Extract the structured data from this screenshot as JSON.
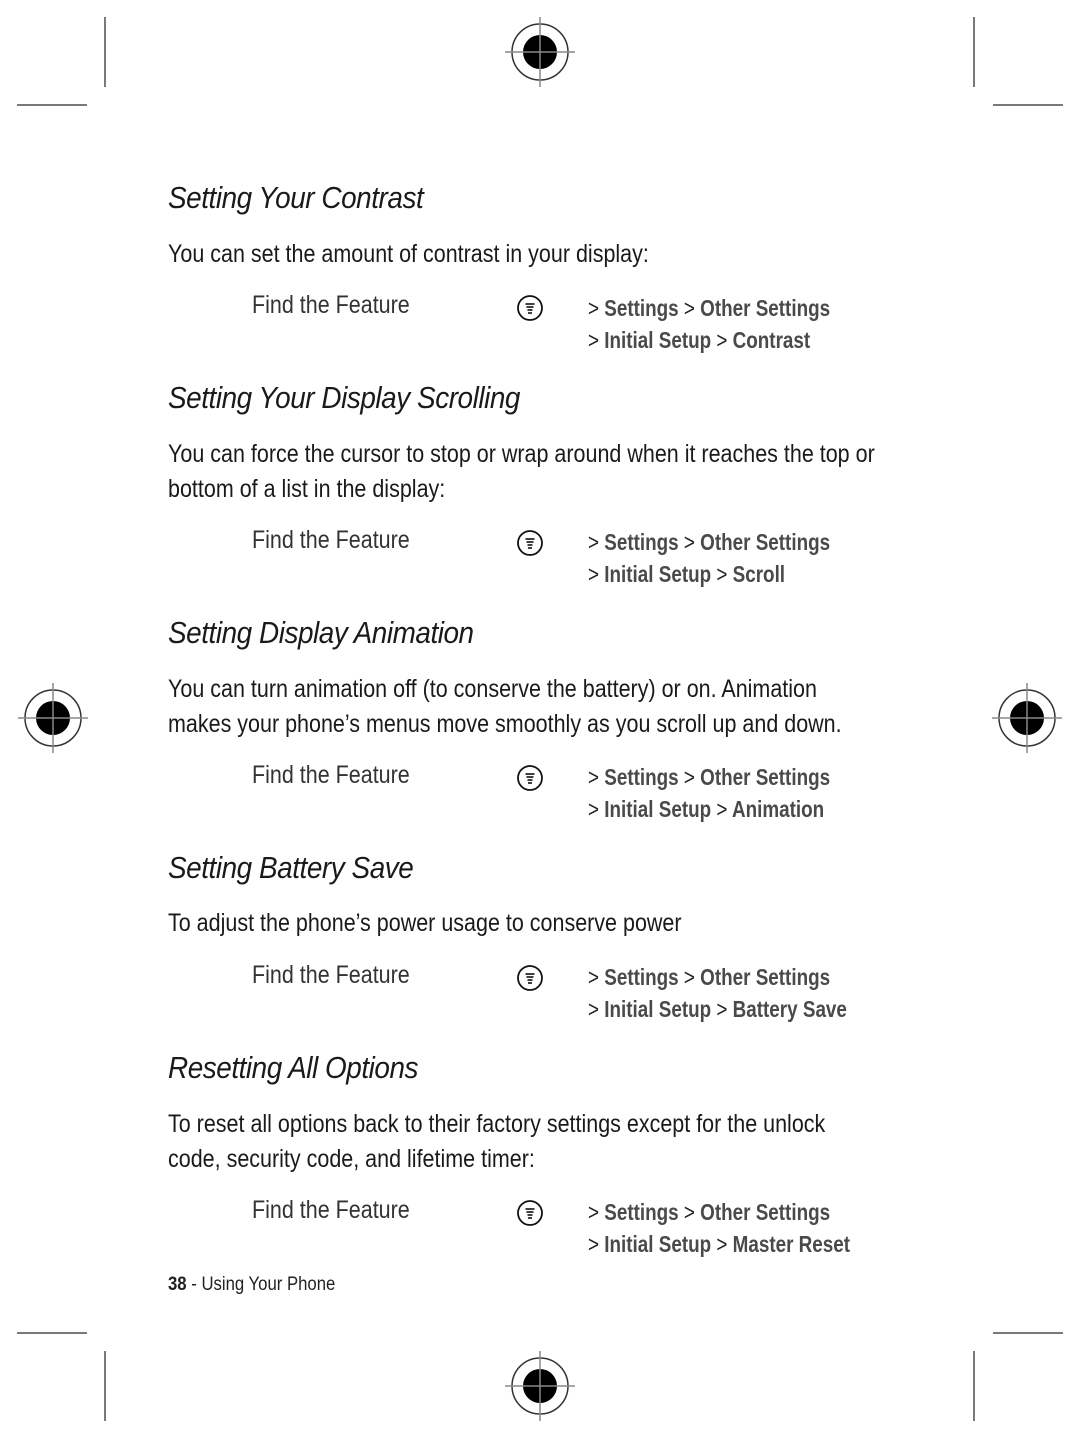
{
  "sections": [
    {
      "title": "Setting Your Contrast",
      "body": [
        "You can set the amount of contrast in your display:"
      ],
      "find_label": "Find the Feature",
      "path_line1": [
        "Settings",
        "Other Settings"
      ],
      "path_line2": [
        "Initial Setup",
        "Contrast"
      ]
    },
    {
      "title": "Setting Your Display Scrolling",
      "body": [
        "You can force the cursor to stop or wrap around when it reaches the top or",
        "bottom of a list in the display:"
      ],
      "find_label": "Find the Feature",
      "path_line1": [
        "Settings",
        "Other Settings"
      ],
      "path_line2": [
        "Initial Setup",
        "Scroll"
      ]
    },
    {
      "title": "Setting Display Animation",
      "body": [
        "You can turn animation off (to conserve the battery) or on. Animation",
        "makes your phone’s menus move smoothly as you scroll up and down."
      ],
      "find_label": "Find the Feature",
      "path_line1": [
        "Settings",
        "Other Settings"
      ],
      "path_line2": [
        "Initial Setup",
        "Animation"
      ]
    },
    {
      "title": "Setting Battery Save",
      "body": [
        "To adjust the phone’s power usage to conserve power"
      ],
      "find_label": "Find the Feature",
      "path_line1": [
        "Settings",
        "Other Settings"
      ],
      "path_line2": [
        "Initial Setup",
        "Battery Save"
      ]
    },
    {
      "title": "Resetting All Options",
      "body": [
        "To reset all options back to their factory settings except for the unlock",
        "code, security code, and lifetime timer:"
      ],
      "find_label": "Find the Feature",
      "path_line1": [
        "Settings",
        "Other Settings"
      ],
      "path_line2": [
        "Initial Setup",
        "Master Reset"
      ]
    }
  ],
  "separator": ">",
  "footer": {
    "page_number": "38",
    "dash": " - ",
    "chapter": "Using Your Phone"
  },
  "icons": {
    "menu_key": "menu-key-icon",
    "registration": "registration-mark-icon"
  }
}
